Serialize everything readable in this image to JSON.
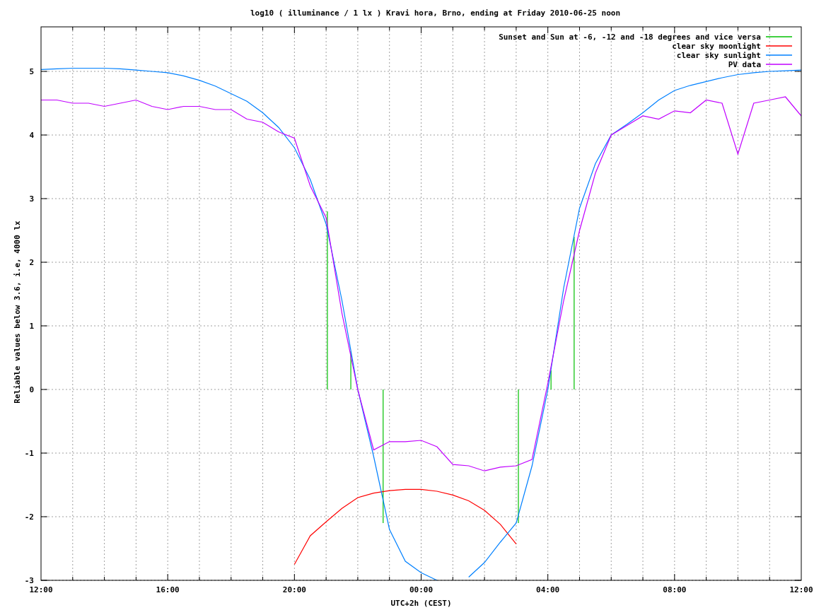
{
  "chart_data": {
    "type": "line",
    "title": "log10 ( illuminance / 1 lx ) Kravi hora, Brno, ending at Friday 2010-06-25 noon",
    "xlabel": "UTC+2h (CEST)",
    "ylabel": "Reliable values below 3.6, i.e, 4000 lx",
    "ylim": [
      -3,
      5.7
    ],
    "yticks": [
      -3,
      -2,
      -1,
      0,
      1,
      2,
      3,
      4,
      5
    ],
    "categories": [
      "12:00",
      null,
      null,
      null,
      null,
      null,
      null,
      null,
      "16:00",
      null,
      null,
      null,
      null,
      null,
      null,
      null,
      "20:00",
      null,
      null,
      null,
      null,
      null,
      null,
      null,
      "00:00",
      null,
      null,
      null,
      null,
      null,
      null,
      null,
      "04:00",
      null,
      null,
      null,
      null,
      null,
      null,
      null,
      "08:00",
      null,
      null,
      null,
      null,
      null,
      null,
      null,
      "12:00"
    ],
    "series": [
      {
        "name": "Sunset and Sun at -6, -12 and -18 degrees and vice versa",
        "color": "#00c000",
        "values": [
          null,
          null,
          null,
          null,
          null,
          null,
          null,
          null,
          null,
          null,
          null,
          null,
          null,
          null,
          null,
          null,
          null,
          null,
          null,
          null,
          null,
          null,
          null,
          null,
          null,
          null,
          null,
          null,
          null,
          null,
          null,
          null,
          null,
          null,
          null,
          null,
          null,
          null,
          null,
          null,
          null,
          null,
          null,
          null,
          null,
          null,
          null,
          null,
          null
        ]
      },
      {
        "name": "clear sky moonlight",
        "color": "#ff0000",
        "values": [
          null,
          null,
          null,
          null,
          null,
          null,
          null,
          null,
          null,
          null,
          null,
          null,
          null,
          null,
          null,
          null,
          -2.75,
          -2.3,
          -2.08,
          -1.87,
          -1.7,
          -1.63,
          -1.59,
          -1.57,
          -1.57,
          -1.6,
          -1.66,
          -1.75,
          -1.9,
          -2.12,
          -2.43,
          null,
          null,
          null,
          null,
          null,
          null,
          null,
          null,
          null,
          null,
          null,
          null,
          null,
          null,
          null,
          null,
          null,
          null
        ]
      },
      {
        "name": "clear sky sunlight",
        "color": "#0080ff",
        "values": [
          5.03,
          5.04,
          5.05,
          5.05,
          5.05,
          5.04,
          5.02,
          5.0,
          4.98,
          4.93,
          4.86,
          4.77,
          4.65,
          4.53,
          4.35,
          4.12,
          3.8,
          3.3,
          2.6,
          1.4,
          0,
          -1.05,
          -2.2,
          -2.7,
          -2.88,
          -3,
          null,
          -2.95,
          -2.72,
          -2.4,
          -2.1,
          -1.2,
          0,
          1.6,
          2.85,
          3.55,
          4.0,
          4.17,
          4.35,
          4.55,
          4.7,
          4.78,
          4.84,
          4.9,
          4.95,
          4.98,
          5.0,
          5.01,
          5.02
        ]
      },
      {
        "name": "PV data",
        "color": "#c000ff",
        "values": [
          4.55,
          4.55,
          4.5,
          4.5,
          4.45,
          4.5,
          4.55,
          4.45,
          4.4,
          4.45,
          4.45,
          4.4,
          4.4,
          4.25,
          4.2,
          4.05,
          3.95,
          3.2,
          2.7,
          1.2,
          0.0,
          -0.95,
          -0.82,
          -0.82,
          -0.8,
          -0.9,
          -1.18,
          -1.2,
          -1.28,
          -1.22,
          -1.2,
          -1.1,
          0.1,
          1.4,
          2.5,
          3.4,
          4.0,
          4.15,
          4.3,
          4.25,
          4.38,
          4.35,
          4.55,
          4.5,
          3.7,
          4.5,
          4.55,
          4.6,
          4.3
        ]
      }
    ],
    "grid": true,
    "legend": true
  }
}
